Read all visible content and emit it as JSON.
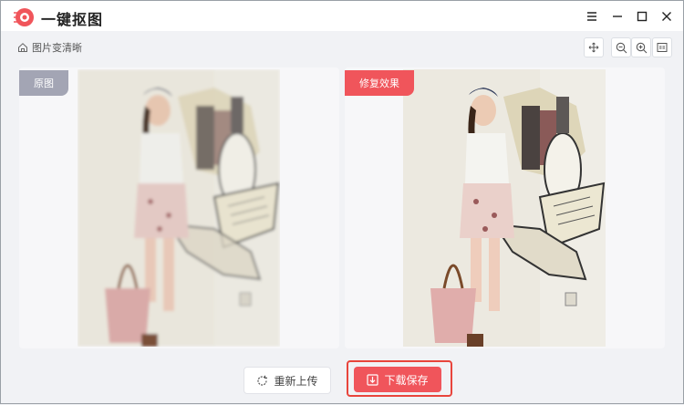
{
  "app": {
    "title": "一键抠图"
  },
  "breadcrumb": {
    "label": "图片变清晰"
  },
  "panels": {
    "original_tag": "原图",
    "result_tag": "修复效果"
  },
  "actions": {
    "reupload_label": "重新上传",
    "download_label": "下载保存"
  },
  "colors": {
    "accent": "#f0555b",
    "tag_gray": "#a3a5b4",
    "highlight_border": "#e8453c"
  },
  "icons": [
    "logo-icon",
    "menu-icon",
    "minimize-icon",
    "maximize-icon",
    "close-icon",
    "home-icon",
    "move-icon",
    "zoom-out-icon",
    "zoom-in-icon",
    "fit-icon",
    "refresh-icon",
    "download-icon"
  ]
}
